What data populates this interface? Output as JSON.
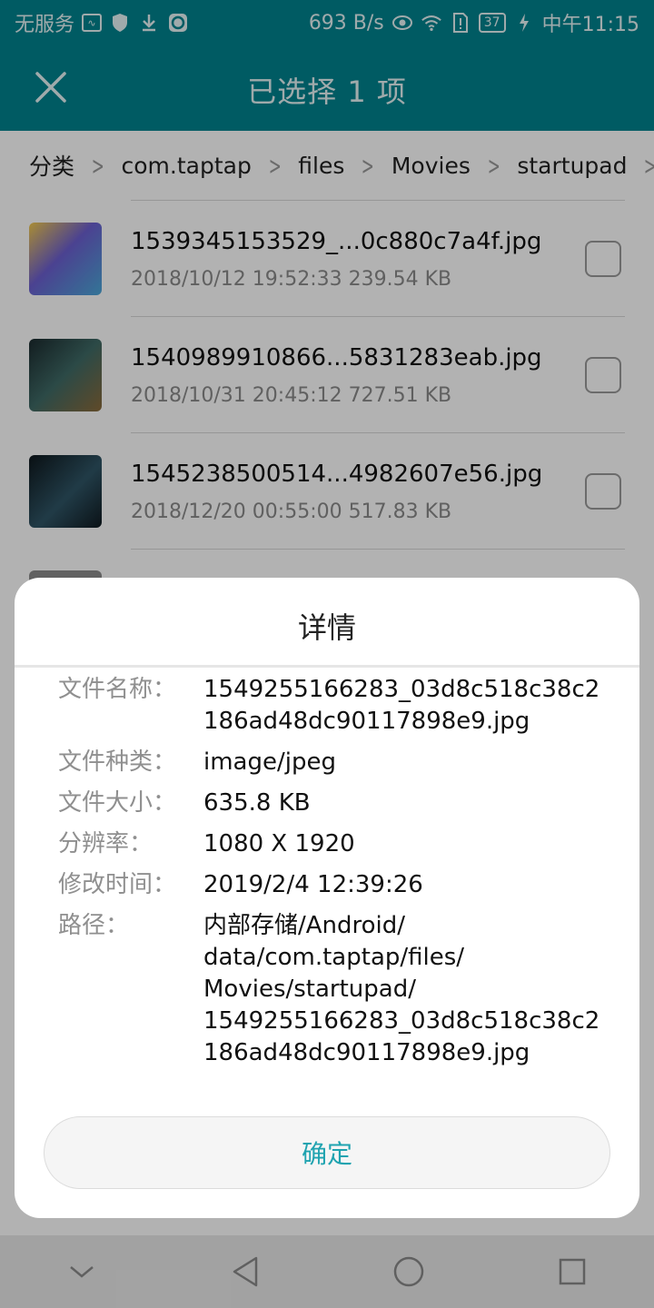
{
  "status_bar": {
    "carrier": "无服务",
    "speed": "693 B/s",
    "battery": "37",
    "time": "中午11:15",
    "icons": [
      "activity-icon",
      "shield-icon",
      "download-icon",
      "app-icon",
      "eye-icon",
      "wifi-icon",
      "sim-alert-icon",
      "battery-icon",
      "charging-icon"
    ]
  },
  "header": {
    "title": "已选择 1 项",
    "close_icon": "close-icon"
  },
  "breadcrumb": [
    "分类",
    "com.taptap",
    "files",
    "Movies",
    "startupad"
  ],
  "files": [
    {
      "name": "1539345153529_...0c880c7a4f.jpg",
      "meta": "2018/10/12 19:52:33 239.54 KB",
      "thumb_color": "#6c5fd0"
    },
    {
      "name": "1540989910866...5831283eab.jpg",
      "meta": "2018/10/31 20:45:12 727.51 KB",
      "thumb_color": "#2d4a4a"
    },
    {
      "name": "1545238500514...4982607e56.jpg",
      "meta": "2018/12/20 00:55:00 517.83 KB",
      "thumb_color": "#1d2c36"
    }
  ],
  "dialog": {
    "title": "详情",
    "rows": [
      {
        "label": "文件名称：",
        "value": "1549255166283_03d8c518c38c2186ad48dc90117898e9.jpg"
      },
      {
        "label": "文件种类：",
        "value": "image/jpeg"
      },
      {
        "label": "文件大小：",
        "value": "635.8 KB"
      },
      {
        "label": "分辨率：",
        "value": "1080 X 1920"
      },
      {
        "label": "修改时间：",
        "value": "2019/2/4 12:39:26"
      },
      {
        "label": "路径：",
        "value": "内部存储/Android/\ndata/com.taptap/files/\nMovies/startupad/\n1549255166283_03d8c518c38c2186ad48dc90117898e9.jpg"
      }
    ],
    "ok_label": "确定"
  },
  "nav_bar": [
    "chevron-down-icon",
    "back-icon",
    "home-icon",
    "recents-icon"
  ],
  "colors": {
    "accent": "#00838f",
    "button_text": "#1fa3b0"
  }
}
